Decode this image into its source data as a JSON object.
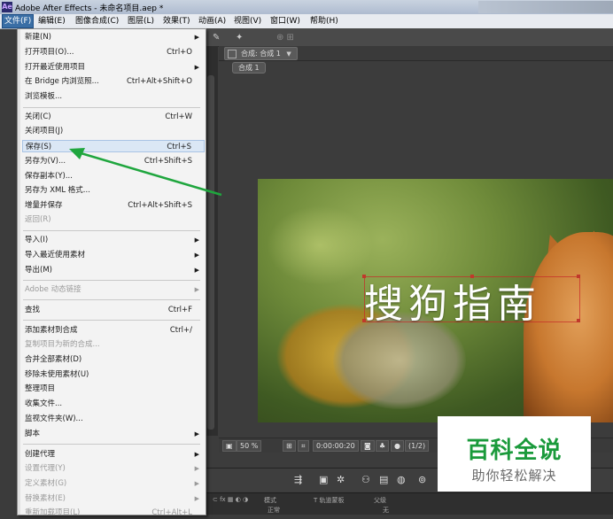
{
  "window": {
    "title": "Adobe After Effects - 未命名项目.aep *",
    "app_icon": "Ae"
  },
  "menubar": [
    {
      "label": "文件(F)",
      "active": true
    },
    {
      "label": "编辑(E)"
    },
    {
      "label": "图像合成(C)"
    },
    {
      "label": "图层(L)"
    },
    {
      "label": "效果(T)"
    },
    {
      "label": "动画(A)"
    },
    {
      "label": "视图(V)"
    },
    {
      "label": "窗口(W)"
    },
    {
      "label": "帮助(H)"
    }
  ],
  "file_menu": {
    "items": [
      {
        "label": "新建(N)",
        "shortcut": "",
        "submenu": true
      },
      {
        "label": "打开项目(O)...",
        "shortcut": "Ctrl+O"
      },
      {
        "label": "打开最近使用项目",
        "shortcut": "",
        "submenu": true
      },
      {
        "label": "在 Bridge 内浏览照...",
        "shortcut": "Ctrl+Alt+Shift+O"
      },
      {
        "label": "浏览模板...",
        "shortcut": ""
      },
      {
        "label": "关闭(C)",
        "shortcut": "Ctrl+W"
      },
      {
        "label": "关闭项目(J)",
        "shortcut": ""
      },
      {
        "label": "保存(S)",
        "shortcut": "Ctrl+S",
        "highlighted": true
      },
      {
        "label": "另存为(V)...",
        "shortcut": "Ctrl+Shift+S"
      },
      {
        "label": "保存副本(Y)...",
        "shortcut": ""
      },
      {
        "label": "另存为 XML 格式...",
        "shortcut": ""
      },
      {
        "label": "增量并保存",
        "shortcut": "Ctrl+Alt+Shift+S"
      },
      {
        "label": "返回(R)",
        "shortcut": "",
        "disabled": true
      },
      {
        "label": "导入(I)",
        "shortcut": "",
        "submenu": true
      },
      {
        "label": "导入最近使用素材",
        "shortcut": "",
        "submenu": true
      },
      {
        "label": "导出(M)",
        "shortcut": "",
        "submenu": true
      },
      {
        "label": "Adobe 动态链接",
        "shortcut": "",
        "submenu": true,
        "disabled": true
      },
      {
        "label": "查找",
        "shortcut": "Ctrl+F"
      },
      {
        "label": "添加素材到合成",
        "shortcut": "Ctrl+/"
      },
      {
        "label": "复制项目为新的合成...",
        "shortcut": "",
        "disabled": true
      },
      {
        "label": "合并全部素材(D)",
        "shortcut": ""
      },
      {
        "label": "移除未使用素材(U)",
        "shortcut": ""
      },
      {
        "label": "整理项目",
        "shortcut": ""
      },
      {
        "label": "收集文件...",
        "shortcut": ""
      },
      {
        "label": "监视文件夹(W)...",
        "shortcut": ""
      },
      {
        "label": "脚本",
        "shortcut": "",
        "submenu": true
      },
      {
        "label": "创建代理",
        "shortcut": "",
        "submenu": true
      },
      {
        "label": "设置代理(Y)",
        "shortcut": "",
        "submenu": true,
        "disabled": true
      },
      {
        "label": "定义素材(G)",
        "shortcut": "",
        "submenu": true,
        "disabled": true
      },
      {
        "label": "替换素材(E)",
        "shortcut": "",
        "submenu": true,
        "disabled": true
      },
      {
        "label": "重新加载项目(L)",
        "shortcut": "Ctrl+Alt+L",
        "disabled": true
      }
    ]
  },
  "composition": {
    "tab_label": "合成: 合成 1",
    "sub_tab": "合成 1",
    "caption_text": "搜狗指南",
    "zoom": "50 %",
    "timecode": "0:00:00:20",
    "resolution": "(1/2)"
  },
  "timeline_head": {
    "col_mode": "模式",
    "col_trkmat": "T  轨道蒙板",
    "col_parent": "父级",
    "mode_value": "正常",
    "parent_value": "无"
  },
  "watermark": {
    "title": "百科全说",
    "subtitle": "助你轻松解决"
  },
  "colors": {
    "arrow": "#1fa63e",
    "menu_highlight": "#dbe7f5",
    "watermark_green": "#1a9a3b"
  }
}
